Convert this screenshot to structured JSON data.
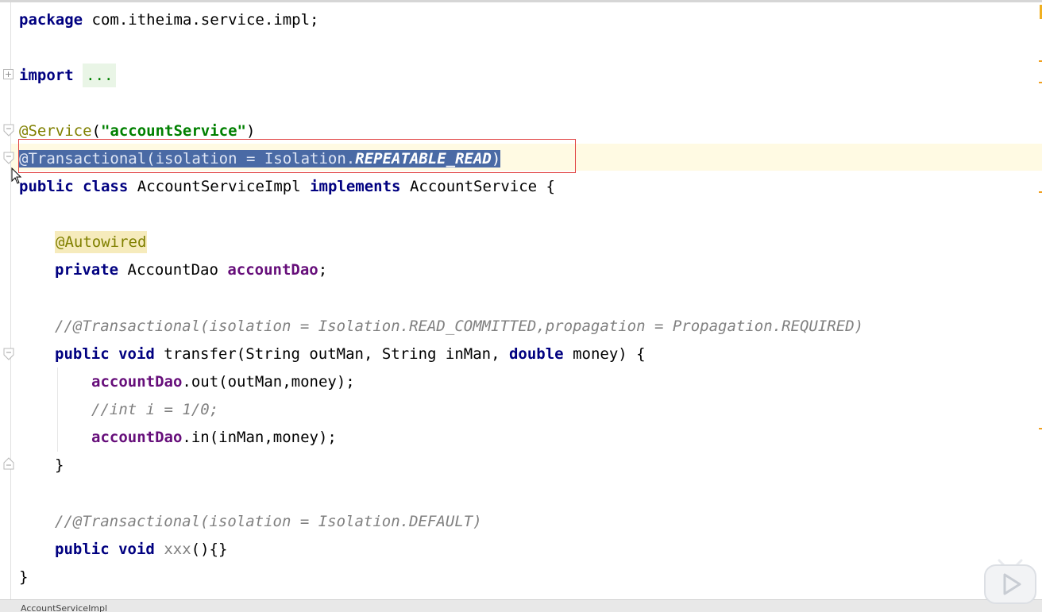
{
  "editor": {
    "lines": {
      "package_kw": "package",
      "package_name": " com.itheima.service.impl;",
      "import_kw": "import",
      "import_fold": "...",
      "service_ann": "@Service",
      "service_open": "(",
      "service_str": "\"accountService\"",
      "service_close": ")",
      "tx_ann": "@Transactional(isolation = Isolation.",
      "tx_const": "REPEATABLE_READ",
      "tx_close": ")",
      "class_public": "public",
      "class_class": "class",
      "class_name": "AccountServiceImpl",
      "class_implements": "implements",
      "class_iface": "AccountService {",
      "autowired": "@Autowired",
      "field_private": "private",
      "field_type": " AccountDao ",
      "field_name": "accountDao",
      "field_semi": ";",
      "comment1": "//@Transactional(isolation = Isolation.READ_COMMITTED,propagation = Propagation.REQUIRED)",
      "method_public": "public",
      "method_void": "void",
      "method_sig_a": " transfer(String outMan, String inMan, ",
      "method_double": "double",
      "method_sig_b": " money) {",
      "out_field": "accountDao",
      "out_call": ".out(outMan,money);",
      "comment_int": "//int i = 1/0;",
      "in_field": "accountDao",
      "in_call": ".in(inMan,money);",
      "method_close": "}",
      "comment2": "//@Transactional(isolation = Isolation.DEFAULT)",
      "xxx_public": "public",
      "xxx_void": "void",
      "xxx_name": "xxx",
      "xxx_body": "(){}",
      "class_close": "}"
    }
  },
  "status": {
    "text": "AccountServiceImpl"
  },
  "colors": {
    "keyword": "#000080",
    "annotation": "#808000",
    "string": "#008000",
    "field": "#660e7a",
    "comment": "#808080",
    "selection": "#4a6aa5",
    "highlight_box": "#e04040"
  },
  "icons": [
    "fold-expand-icon",
    "fold-collapse-icon",
    "mouse-cursor-icon",
    "play-overlay-icon"
  ]
}
